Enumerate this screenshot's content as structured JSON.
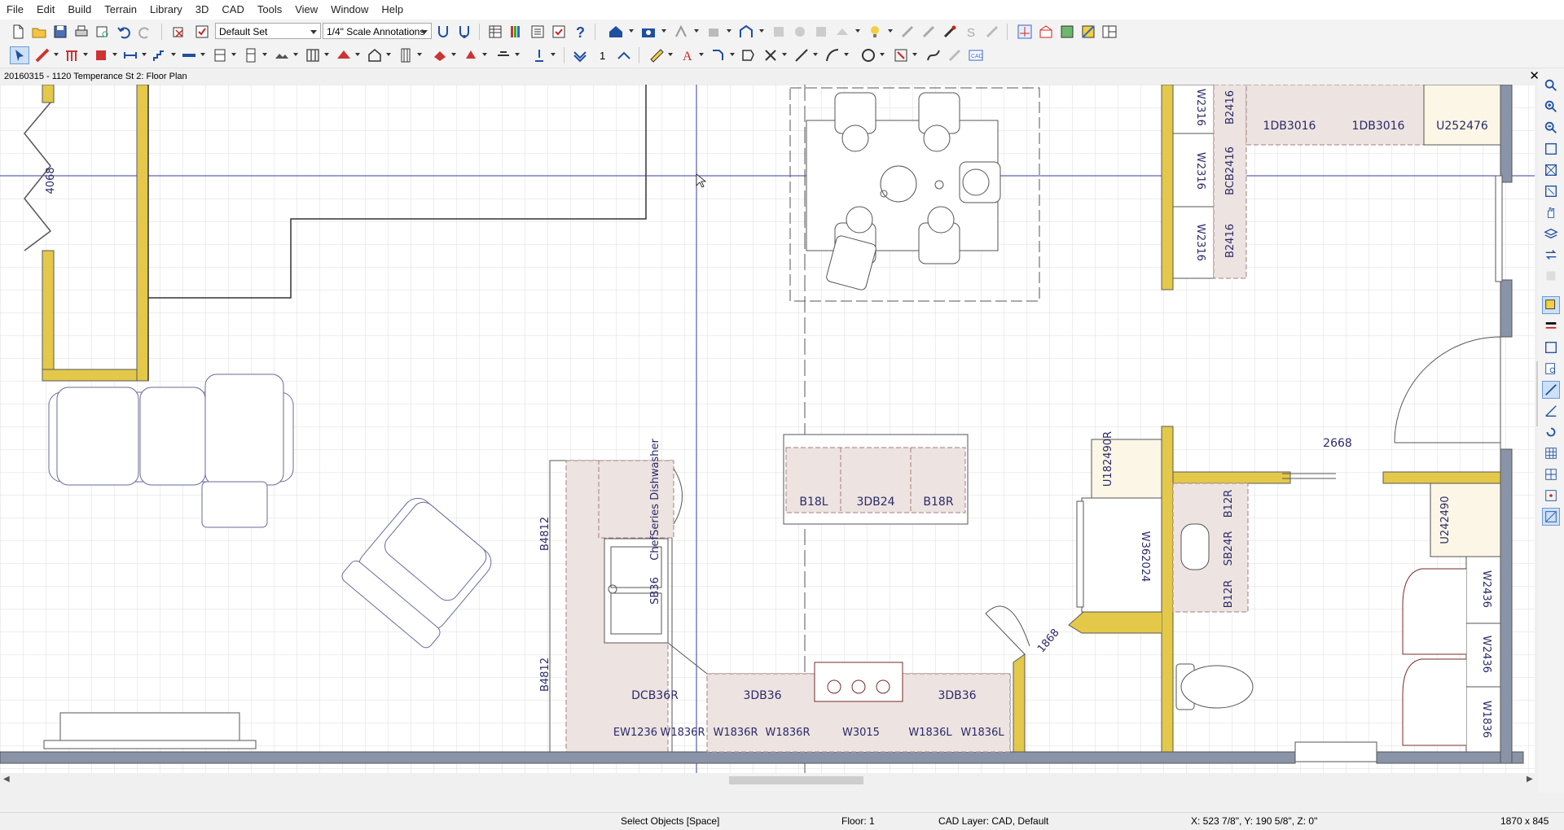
{
  "menu": [
    "File",
    "Edit",
    "Build",
    "Terrain",
    "Library",
    "3D",
    "CAD",
    "Tools",
    "View",
    "Window",
    "Help"
  ],
  "toolbar": {
    "layer_set": "Default Set",
    "annotation_set": "1/4\" Scale Annotations",
    "floor_number": "1"
  },
  "document": {
    "title": "20160315 - 1120 Temperance St 2: Floor Plan",
    "close_glyph": "✕"
  },
  "plan": {
    "door_labels": [
      "4068",
      "2668",
      "1868"
    ],
    "cabinet_labels": {
      "top_wall": [
        "W2316",
        "W2316",
        "W2316"
      ],
      "top_base": [
        "B2416",
        "BCB2416",
        "B2416"
      ],
      "top_row": [
        "1DB3016",
        "1DB3016",
        "U252476"
      ],
      "island": [
        "B18L",
        "3DB24",
        "B18R"
      ],
      "left_run": [
        "B4812",
        "B4812"
      ],
      "sink_run": [
        "SB36",
        "ChefSeries Dishwasher"
      ],
      "bottom_base": [
        "DCB36R",
        "3DB36",
        "3DB36"
      ],
      "bottom_wall": [
        "EW1236",
        "W1836R",
        "W1836R",
        "W1836R",
        "W3015",
        "W1836L",
        "W1836L"
      ],
      "pantry": [
        "U182490R",
        "W362024"
      ],
      "bath": [
        "B12R",
        "SB24R",
        "B12R"
      ],
      "right_wall": [
        "U242490",
        "W2436",
        "W2436",
        "W1836"
      ]
    }
  },
  "status": {
    "mode": "Select Objects [Space]",
    "floor": "Floor: 1",
    "layer": "CAD Layer: CAD,  Default",
    "coords": "X: 523 7/8\", Y: 190 5/8\", Z: 0\"",
    "size": "1870 x 845"
  },
  "colors": {
    "wall_fill": "#e3c84a",
    "wall_outline": "#5a5a5a",
    "exterior_wall": "#8a94a8",
    "cabinet_fill": "#ede3e0",
    "line_blue": "#3a3aa8",
    "grid": "#dcdcdc"
  }
}
